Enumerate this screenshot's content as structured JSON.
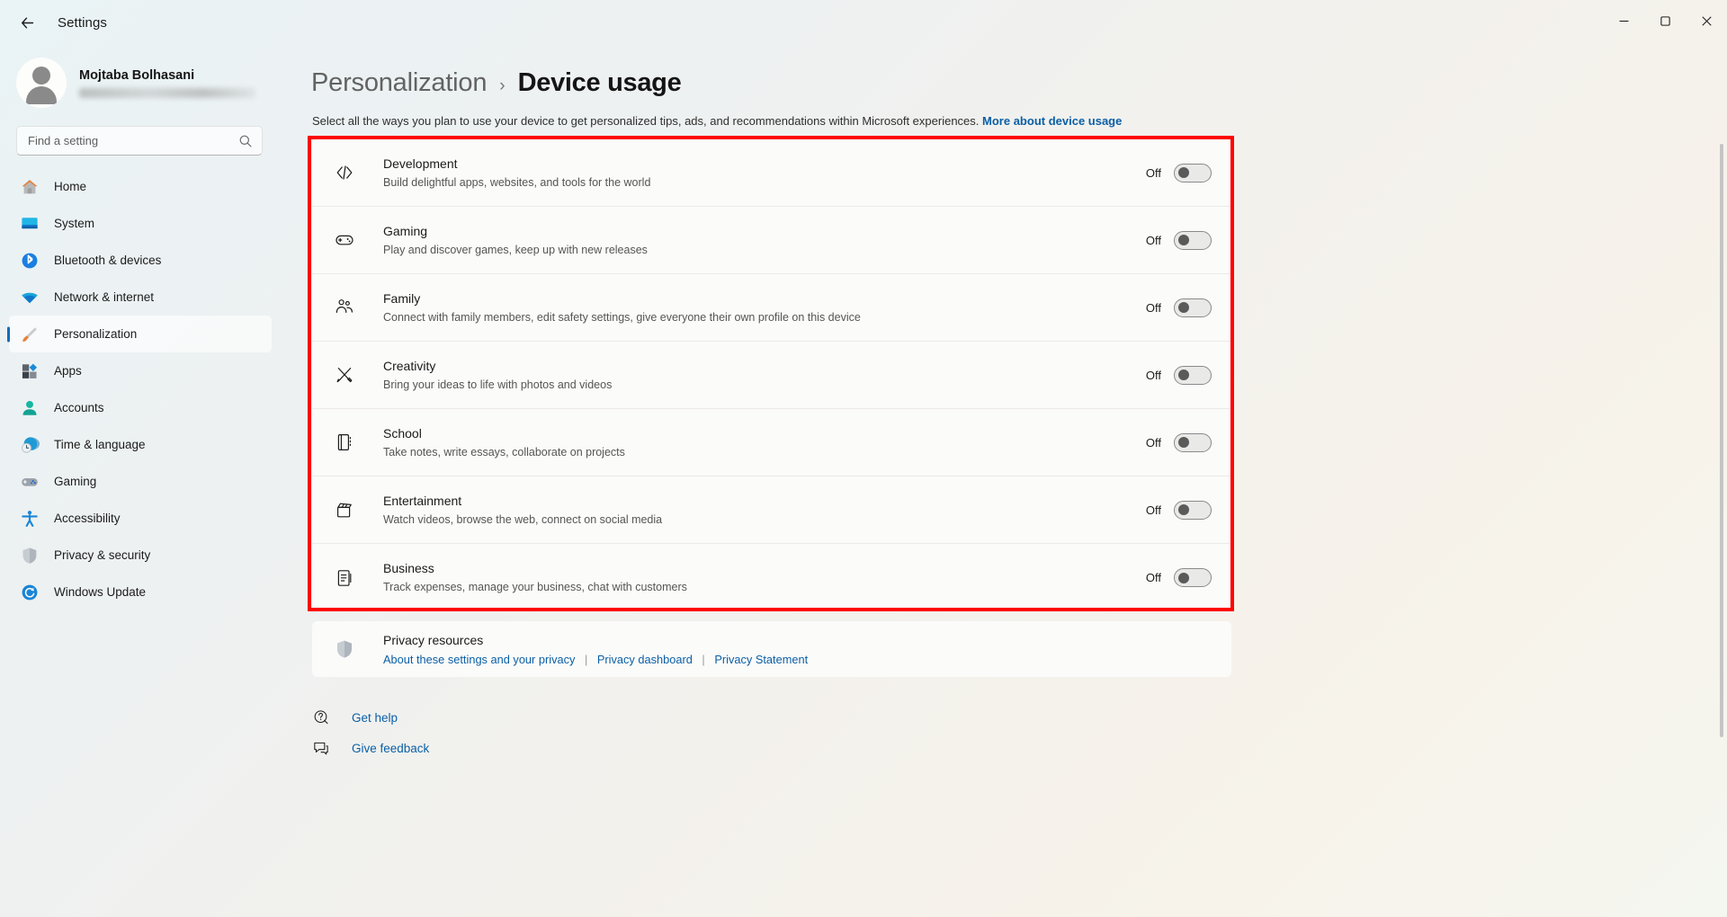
{
  "window": {
    "title": "Settings",
    "back_icon": "back-arrow-icon",
    "minimize": "–",
    "maximize": "❑",
    "close": "✕"
  },
  "account": {
    "name": "Mojtaba Bolhasani",
    "email_masked": ""
  },
  "search": {
    "placeholder": "Find a setting",
    "value": "",
    "icon": "search-icon"
  },
  "sidebar": {
    "items": [
      {
        "label": "Home",
        "icon": "home-icon",
        "active": false
      },
      {
        "label": "System",
        "icon": "system-icon",
        "active": false
      },
      {
        "label": "Bluetooth & devices",
        "icon": "bluetooth-icon",
        "active": false
      },
      {
        "label": "Network & internet",
        "icon": "network-icon",
        "active": false
      },
      {
        "label": "Personalization",
        "icon": "paintbrush-icon",
        "active": true
      },
      {
        "label": "Apps",
        "icon": "apps-icon",
        "active": false
      },
      {
        "label": "Accounts",
        "icon": "accounts-icon",
        "active": false
      },
      {
        "label": "Time & language",
        "icon": "clock-globe-icon",
        "active": false
      },
      {
        "label": "Gaming",
        "icon": "gamepad-icon",
        "active": false
      },
      {
        "label": "Accessibility",
        "icon": "accessibility-icon",
        "active": false
      },
      {
        "label": "Privacy & security",
        "icon": "shield-icon",
        "active": false
      },
      {
        "label": "Windows Update",
        "icon": "update-icon",
        "active": false
      }
    ]
  },
  "page": {
    "breadcrumb_parent": "Personalization",
    "breadcrumb_separator": "›",
    "breadcrumb_current": "Device usage",
    "description": "Select all the ways you plan to use your device to get personalized tips, ads, and recommendations within Microsoft experiences.",
    "description_link": "More about device usage"
  },
  "device_usage": {
    "rows": [
      {
        "title": "Development",
        "subtitle": "Build delightful apps, websites, and tools for the world",
        "icon": "code-brackets-icon",
        "state_label": "Off",
        "on": false
      },
      {
        "title": "Gaming",
        "subtitle": "Play and discover games, keep up with new releases",
        "icon": "gamepad-icon",
        "state_label": "Off",
        "on": false
      },
      {
        "title": "Family",
        "subtitle": "Connect with family members, edit safety settings, give everyone their own profile on this device",
        "icon": "people-icon",
        "state_label": "Off",
        "on": false
      },
      {
        "title": "Creativity",
        "subtitle": "Bring your ideas to life with photos and videos",
        "icon": "pen-brush-icon",
        "state_label": "Off",
        "on": false
      },
      {
        "title": "School",
        "subtitle": "Take notes, write essays, collaborate on projects",
        "icon": "notebook-icon",
        "state_label": "Off",
        "on": false
      },
      {
        "title": "Entertainment",
        "subtitle": "Watch videos, browse the web, connect on social media",
        "icon": "clapperboard-icon",
        "state_label": "Off",
        "on": false
      },
      {
        "title": "Business",
        "subtitle": "Track expenses, manage your business, chat with customers",
        "icon": "briefcase-document-icon",
        "state_label": "Off",
        "on": false
      }
    ]
  },
  "privacy": {
    "icon": "shield-icon",
    "title": "Privacy resources",
    "links": [
      "About these settings and your privacy",
      "Privacy dashboard",
      "Privacy Statement"
    ],
    "separator": "|"
  },
  "footer": {
    "items": [
      {
        "label": "Get help",
        "icon": "help-icon"
      },
      {
        "label": "Give feedback",
        "icon": "feedback-icon"
      }
    ]
  },
  "annotation": {
    "color": "#ff0000"
  }
}
